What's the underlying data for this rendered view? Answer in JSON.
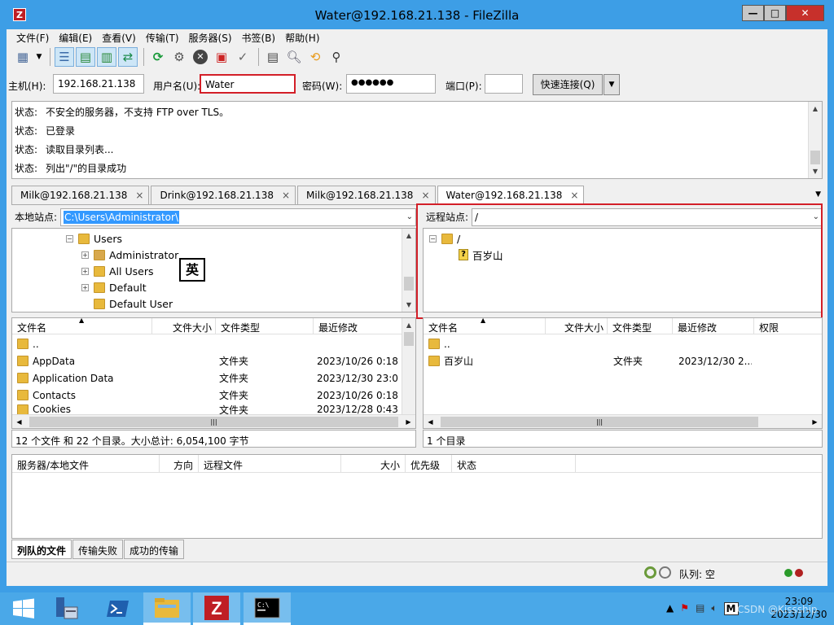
{
  "window": {
    "title": "Water@192.168.21.138 - FileZilla",
    "icon_letter": "Z"
  },
  "menu": [
    "文件(F)",
    "编辑(E)",
    "查看(V)",
    "传输(T)",
    "服务器(S)",
    "书签(B)",
    "帮助(H)"
  ],
  "toolbar_icons": [
    "site-manager-icon",
    "dropdown-arrow-icon",
    "toggle-log-icon",
    "toggle-local-tree-icon",
    "toggle-remote-tree-icon",
    "toggle-queue-icon",
    "refresh-icon",
    "process-queue-icon",
    "cancel-icon",
    "disconnect-icon",
    "reconnect-icon",
    "filter-icon",
    "compare-icon",
    "sync-browse-icon",
    "search-icon"
  ],
  "quickconnect": {
    "host_label": "主机(H):",
    "host_value": "192.168.21.138",
    "user_label": "用户名(U):",
    "user_value": "Water",
    "pass_label": "密码(W):",
    "pass_value": "●●●●●●",
    "port_label": "端口(P):",
    "port_value": "",
    "connect_label": "快速连接(Q)"
  },
  "log": [
    {
      "k": "状态:",
      "v": "不安全的服务器，不支持 FTP over TLS。"
    },
    {
      "k": "状态:",
      "v": "已登录"
    },
    {
      "k": "状态:",
      "v": "读取目录列表..."
    },
    {
      "k": "状态:",
      "v": "列出\"/\"的目录成功"
    }
  ],
  "tabs": [
    {
      "label": "Milk@192.168.21.138",
      "close": "×"
    },
    {
      "label": "Drink@192.168.21.138",
      "close": "×"
    },
    {
      "label": "Milk@192.168.21.138",
      "close": "×"
    },
    {
      "label": "Water@192.168.21.138",
      "close": "×"
    }
  ],
  "local": {
    "site_label": "本地站点:",
    "path": "C:\\Users\\Administrator\\",
    "tree": [
      {
        "name": "Users",
        "expand": "−"
      },
      {
        "name": "Administrator",
        "expand": "+"
      },
      {
        "name": "All Users",
        "expand": "+"
      },
      {
        "name": "Default",
        "expand": "+"
      },
      {
        "name": "Default User",
        "expand": ""
      }
    ],
    "columns": [
      "文件名",
      "文件大小",
      "文件类型",
      "最近修改"
    ],
    "files": [
      {
        "name": "..",
        "type": "",
        "modified": ""
      },
      {
        "name": "AppData",
        "type": "文件夹",
        "modified": "2023/10/26 0:18:.."
      },
      {
        "name": "Application Data",
        "type": "文件夹",
        "modified": "2023/12/30 23:0.."
      },
      {
        "name": "Contacts",
        "type": "文件夹",
        "modified": "2023/10/26 0:18:.."
      },
      {
        "name": "Cookies",
        "type": "文件夹",
        "modified": "2023/12/28 0:43:.."
      }
    ],
    "status": "12 个文件 和 22 个目录。大小总计: 6,054,100 字节"
  },
  "ime": "英",
  "remote": {
    "site_label": "远程站点:",
    "path": "/",
    "tree": [
      {
        "name": "/",
        "expand": "−"
      },
      {
        "name": "百岁山",
        "expand": ""
      }
    ],
    "columns": [
      "文件名",
      "文件大小",
      "文件类型",
      "最近修改",
      "权限"
    ],
    "files": [
      {
        "name": "..",
        "type": "",
        "modified": ""
      },
      {
        "name": "百岁山",
        "type": "文件夹",
        "modified": "2023/12/30 2..."
      }
    ],
    "status": "1 个目录"
  },
  "queue": {
    "columns": [
      "服务器/本地文件",
      "方向",
      "远程文件",
      "大小",
      "优先级",
      "状态"
    ],
    "tabs": [
      "列队的文件",
      "传输失败",
      "成功的传输"
    ]
  },
  "statusbar": {
    "queue_text": "队列: 空"
  },
  "taskbar": {
    "icons": [
      "start-icon",
      "server-manager-icon",
      "powershell-icon",
      "file-explorer-icon",
      "filezilla-icon",
      "cmd-icon"
    ],
    "time": "23:09",
    "date": "2023/12/30",
    "watermark": "CSDN @Kissship",
    "ime_indicator": "M"
  },
  "colors": {
    "accent": "#3d9ee6",
    "highlight_red": "#d31f28",
    "folder": "#e8b93c"
  }
}
